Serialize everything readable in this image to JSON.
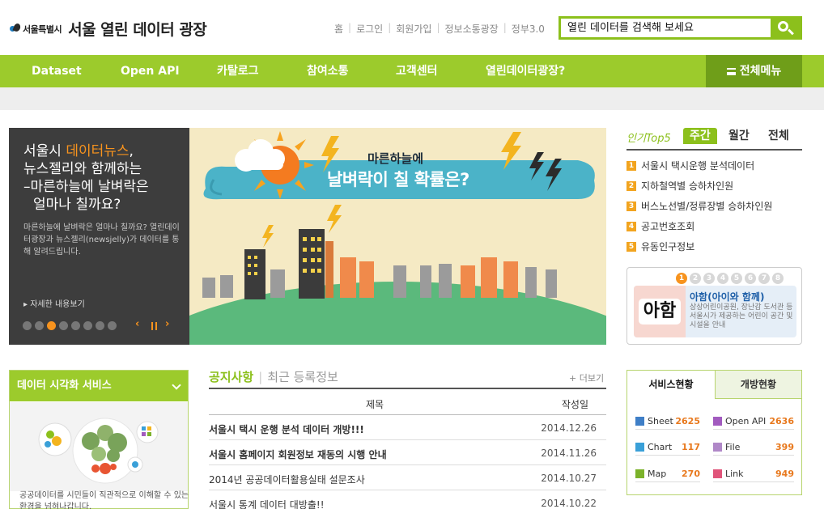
{
  "header": {
    "logo_small": "서울특별시",
    "logo_title": "서울 열린 데이터 광장",
    "top_links": [
      "홈",
      "로그인",
      "회원가입",
      "정보소통광장",
      "정부3.0"
    ],
    "search_placeholder": "열린 데이터를 검색해 보세요"
  },
  "nav": {
    "items": [
      "Dataset",
      "Open API",
      "카탈로그",
      "참여소통",
      "고객센터",
      "열린데이터광장?"
    ],
    "all_menu": "전체메뉴"
  },
  "banner": {
    "title_line1_a": "서울시 ",
    "title_line1_hl": "데이터뉴스",
    "title_line1_b": ",",
    "title_line2": "뉴스젤리와 함께하는",
    "title_line3": "–마른하늘에 날벼락은",
    "title_line4": "얼마나 칠까요?",
    "desc": "마른하늘에 날벼락은 얼마나 칠까요? 열린데이터광장과 뉴스젤리(newsjelly)가 데이터를 통해 알려드립니다.",
    "more": "▸ 자세한 내용보기",
    "image_title1": "마른하늘에",
    "image_title2": "날벼락이 칠 확률은?",
    "slide_count": 8,
    "active_slide": 3
  },
  "popular": {
    "label": "인기Top5",
    "tabs": [
      "주간",
      "월간",
      "전체"
    ],
    "items": [
      "서울시 택시운행 분석데이터",
      "지하철역별 승하차인원",
      "버스노선별/정류장별 승하차인원",
      "공고번호조회",
      "유동인구정보"
    ]
  },
  "aham": {
    "numbers": [
      "1",
      "2",
      "3",
      "4",
      "5",
      "6",
      "7",
      "8"
    ],
    "logo_text": "아함",
    "name": "아함(아이와 함께)",
    "desc": "상상어린이공원, 장난감 도서관 등 서울시가 제공하는 어린이 공간 및 시설을 안내"
  },
  "viz": {
    "title": "데이터 시각화 서비스",
    "desc": "공공데이터를 시민들이 직관적으로 이해할 수 있는 환경을 넘혀나갑니다."
  },
  "notice": {
    "tab_active": "공지사항",
    "tab_inactive": "최근 등록정보",
    "more": "+ 더보기",
    "col_title": "제목",
    "col_date": "작성일",
    "rows": [
      {
        "title": "서울시 택시 운행 분석 데이터 개방!!!",
        "date": "2014.12.26",
        "bold": true
      },
      {
        "title": "서울시 홈페이지 회원정보 재동의 시행 안내",
        "date": "2014.11.26",
        "bold": true
      },
      {
        "title": "2014년 공공데이터활용실태 설문조사",
        "date": "2014.10.27",
        "bold": false
      },
      {
        "title": "서울시 통계 데이터 대방출!!",
        "date": "2014.10.22",
        "bold": false
      }
    ]
  },
  "service": {
    "tab_active": "서비스현황",
    "tab_inactive": "개방현황",
    "items": [
      {
        "label": "Sheet",
        "value": "2625",
        "icon": "sheet-icon",
        "color": "#3f7fc7"
      },
      {
        "label": "Open API",
        "value": "2636",
        "icon": "openapi-icon",
        "color": "#a25bbf"
      },
      {
        "label": "Chart",
        "value": "117",
        "icon": "chart-icon",
        "color": "#3aa0d8"
      },
      {
        "label": "File",
        "value": "399",
        "icon": "file-icon",
        "color": "#b088c8"
      },
      {
        "label": "Map",
        "value": "270",
        "icon": "map-icon",
        "color": "#7bb22a"
      },
      {
        "label": "Link",
        "value": "949",
        "icon": "link-icon",
        "color": "#e0547a"
      }
    ]
  },
  "colors": {
    "brand_green": "#9ccb2c",
    "accent_orange": "#f7931e",
    "dark_green": "#6f9e19"
  }
}
